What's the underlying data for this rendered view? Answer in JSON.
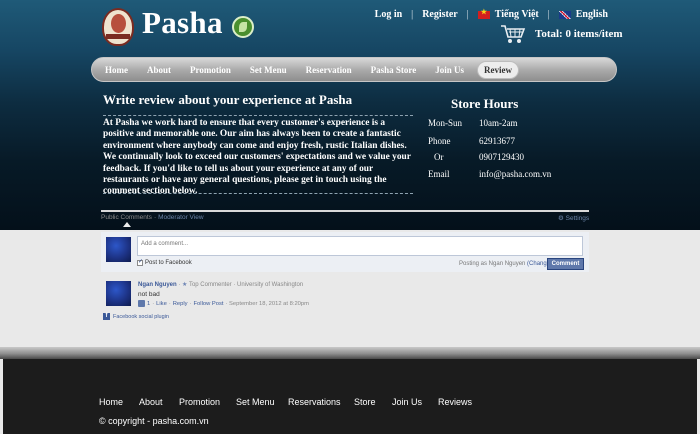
{
  "brand": "Pasha",
  "header": {
    "login": "Log in",
    "register": "Register",
    "sep": "|",
    "lang_vi": "Tiếng Việt",
    "lang_en": "English",
    "cart_total": "Total: 0 items/item"
  },
  "nav": [
    "Home",
    "About",
    "Promotion",
    "Set Menu",
    "Reservation",
    "Pasha Store",
    "Join Us",
    "Review"
  ],
  "nav_active": "Review",
  "review": {
    "title": "Write review about your experience at Pasha",
    "body": "At Pasha we work hard to ensure that every customer's experience is a positive and memorable one. Our aim has always been to create a fantastic environment where anybody can come and enjoy fresh, rustic Italian dishes. We continually look to exceed our customers' expectations and we value your feedback. If you'd like to tell us about your experience at any of our restaurants or have any general questions, please get in touch using the comment section below."
  },
  "hours": {
    "title": "Store Hours",
    "rows": [
      {
        "k": "Mon-Sun",
        "v": "10am-2am"
      },
      {
        "k": "Phone",
        "v": "62913677"
      },
      {
        "k": "Or",
        "v": "0907129430"
      },
      {
        "k": "Email",
        "v": "info@pasha.com.vn"
      }
    ]
  },
  "comments": {
    "tab_public": "Public Comments",
    "tab_moderator": "Moderator View",
    "settings": "Settings",
    "placeholder": "Add a comment...",
    "post_to_facebook": "Post to Facebook",
    "posting_as": "Posting as Ngan Nguyen",
    "change": "(Change)",
    "comment_button": "Comment",
    "item": {
      "author": "Ngan Nguyen",
      "badge": "Top Commenter",
      "school": "· University of Washington",
      "text": "not bad",
      "likes": "1",
      "like": "Like",
      "reply": "Reply",
      "follow": "Follow Post",
      "date": "· September 18, 2012 at 8:20pm"
    },
    "plugin": "Facebook social plugin"
  },
  "footer": {
    "nav": [
      "Home",
      "About",
      "Promotion",
      "Set Menu",
      "Reservations",
      "Store",
      "Join Us",
      "Reviews"
    ],
    "copyright": "© copyright - pasha.com.vn"
  }
}
